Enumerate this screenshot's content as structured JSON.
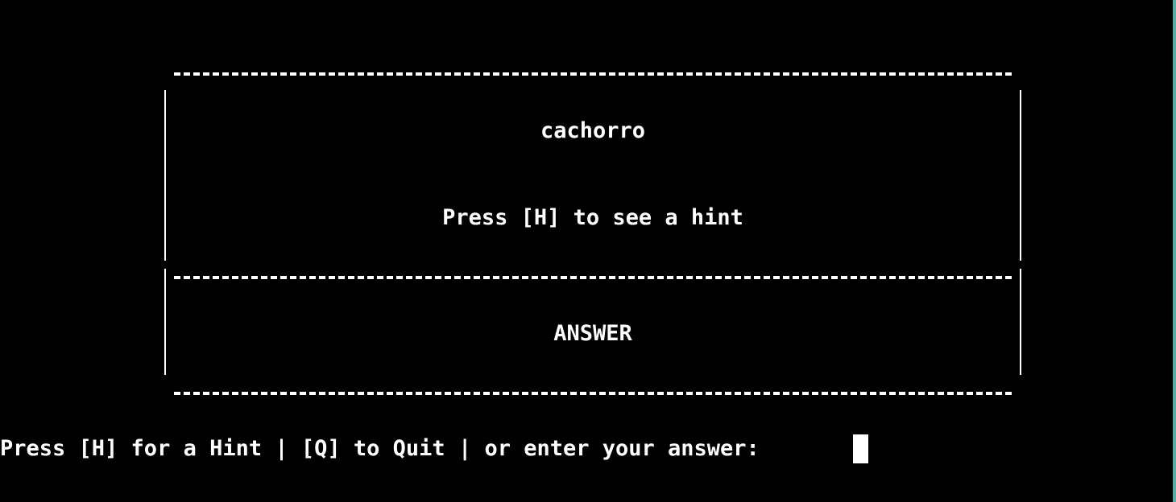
{
  "card": {
    "word": "cachorro",
    "hint_prompt": "Press [H] to see a hint",
    "answer_label": "ANSWER"
  },
  "prompt": {
    "text": "Press [H] for a Hint | [Q] to Quit | or enter your answer: "
  },
  "colors": {
    "background": "#000000",
    "foreground": "#ffffff",
    "window_edge": "#58a9a3"
  }
}
